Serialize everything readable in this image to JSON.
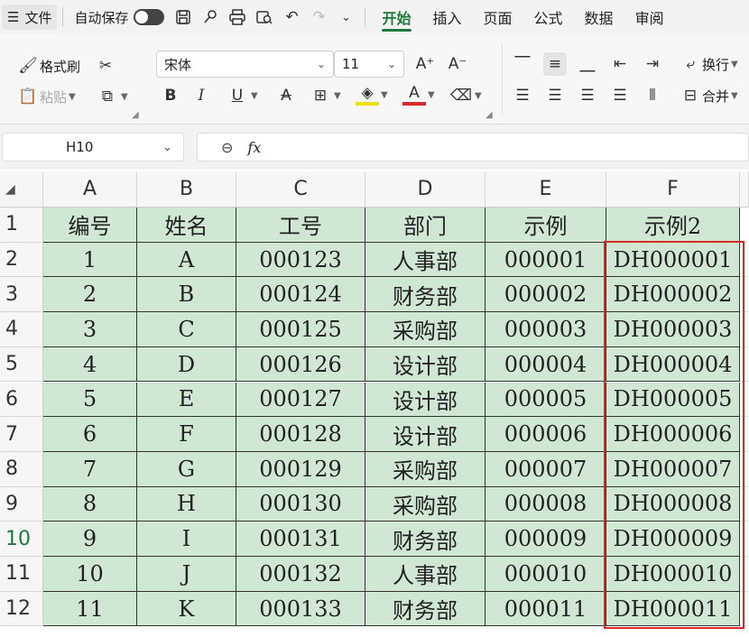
{
  "menubar": {
    "file_label": "文件",
    "autosave_label": "自动保存",
    "tabs": [
      "开始",
      "插入",
      "页面",
      "公式",
      "数据",
      "审阅"
    ],
    "active_tab": "开始"
  },
  "ribbon": {
    "format_painter": "格式刷",
    "paste": "粘贴",
    "font_name": "宋体",
    "font_size": "11",
    "wrap_text": "换行",
    "merge": "合并"
  },
  "formula_bar": {
    "name_box": "H10",
    "fx_label": "fx",
    "formula": ""
  },
  "sheet": {
    "columns": [
      "A",
      "B",
      "C",
      "D",
      "E",
      "F"
    ],
    "row_numbers": [
      "1",
      "2",
      "3",
      "4",
      "5",
      "6",
      "7",
      "8",
      "9",
      "10",
      "11",
      "12"
    ],
    "selected_row": "10",
    "header": [
      "编号",
      "姓名",
      "工号",
      "部门",
      "示例",
      "示例2"
    ],
    "rows": [
      [
        "1",
        "A",
        "000123",
        "人事部",
        "000001",
        "DH000001"
      ],
      [
        "2",
        "B",
        "000124",
        "财务部",
        "000002",
        "DH000002"
      ],
      [
        "3",
        "C",
        "000125",
        "采购部",
        "000003",
        "DH000003"
      ],
      [
        "4",
        "D",
        "000126",
        "设计部",
        "000004",
        "DH000004"
      ],
      [
        "5",
        "E",
        "000127",
        "设计部",
        "000005",
        "DH000005"
      ],
      [
        "6",
        "F",
        "000128",
        "设计部",
        "000006",
        "DH000006"
      ],
      [
        "7",
        "G",
        "000129",
        "采购部",
        "000007",
        "DH000007"
      ],
      [
        "8",
        "H",
        "000130",
        "采购部",
        "000008",
        "DH000008"
      ],
      [
        "9",
        "I",
        "000131",
        "财务部",
        "000009",
        "DH000009"
      ],
      [
        "10",
        "J",
        "000132",
        "人事部",
        "000010",
        "DH000010"
      ],
      [
        "11",
        "K",
        "000133",
        "财务部",
        "000011",
        "DH000011"
      ]
    ]
  },
  "colors": {
    "accent": "#1e7a3c",
    "cell_fill": "#cfe7d3",
    "highlight_border": "#d42a2a"
  }
}
